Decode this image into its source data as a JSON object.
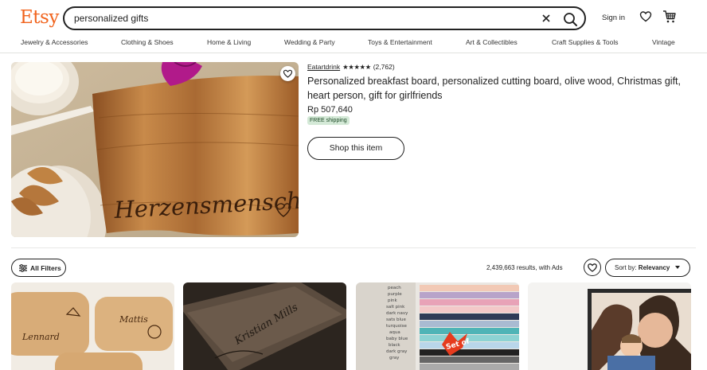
{
  "header": {
    "logo": "Etsy",
    "search_value": "personalized gifts",
    "signin_label": "Sign in",
    "icons": [
      "close-icon",
      "search-icon",
      "heart-icon",
      "cart-icon"
    ]
  },
  "categories": [
    "Jewelry & Accessories",
    "Clothing & Shoes",
    "Home & Living",
    "Wedding & Party",
    "Toys & Entertainment",
    "Art & Collectibles",
    "Craft Supplies & Tools",
    "Vintage"
  ],
  "ad": {
    "shop_name": "Eatartdrink",
    "stars": "★★★★★",
    "rating_count": "(2,762)",
    "title": "Personalized breakfast board, personalized cutting board, olive wood, Christmas gift, heart person, gift for girlfriends",
    "price": "Rp 507,640",
    "shipping_badge": "FREE shipping",
    "shop_button": "Shop this item",
    "image_text": "Herzensmensch"
  },
  "filter_bar": {
    "filters_label": "All Filters",
    "results_text": "2,439,663 results, with Ads",
    "sort_label": "Sort by: ",
    "sort_value": "Relevancy"
  },
  "listings": [
    {
      "image_text": [
        "Lennard",
        "Mattis"
      ]
    },
    {
      "image_text": [
        "Kristian Mills"
      ]
    },
    {
      "image_text": [
        "peach",
        "purple",
        "pink",
        "salt pink",
        "dark navy",
        "sats blue",
        "turquoise",
        "aqua",
        "baby blue",
        "black",
        "dark gray",
        "gray",
        "Set of"
      ]
    },
    {
      "image_text": []
    }
  ],
  "colors": {
    "brand_orange": "#f1641e",
    "free_ship_bg": "#d4e9d7",
    "free_ship_text": "#1e4a27"
  }
}
